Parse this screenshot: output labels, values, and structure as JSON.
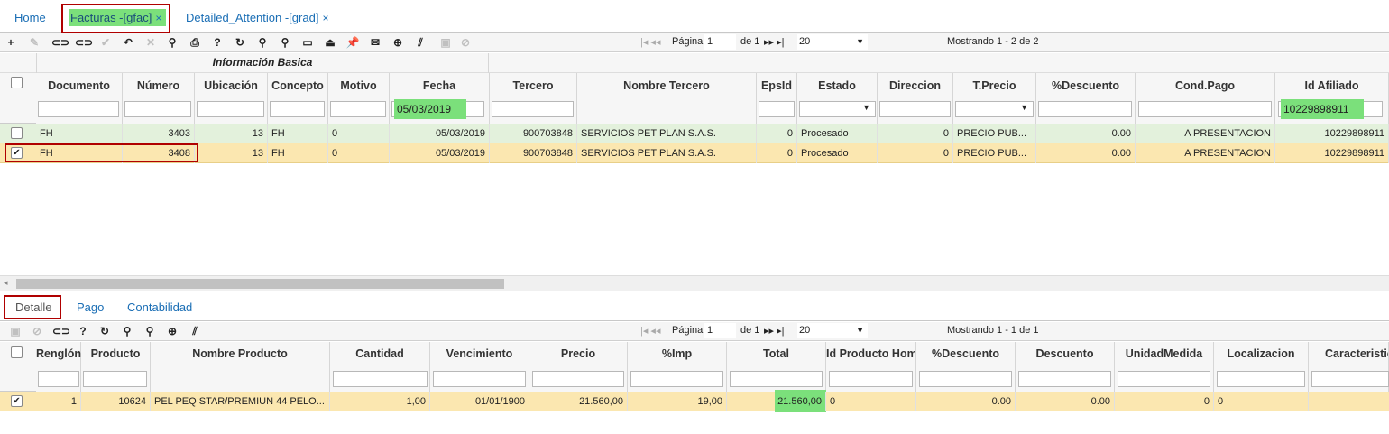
{
  "tabs": [
    {
      "label": "Home"
    },
    {
      "label": "Facturas -[gfac]",
      "close": "×",
      "active": true
    },
    {
      "label": "Detailed_Attention -[grad]",
      "close": "×"
    }
  ],
  "top_pager": {
    "page_label": "Página",
    "page_value": "1",
    "of_label": "de 1",
    "page_size": "20",
    "showing": "Mostrando 1 - 2 de 2"
  },
  "group_header": "Información Basica",
  "top_columns": [
    "Documento",
    "Número",
    "Ubicación",
    "Concepto",
    "Motivo",
    "Fecha",
    "Tercero",
    "Nombre Tercero",
    "EpsId",
    "Estado",
    "Direccion",
    "T.Precio",
    "%Descuento",
    "Cond.Pago",
    "Id Afiliado"
  ],
  "top_filters": {
    "fecha": "05/03/2019",
    "id_afiliado": "10229898911"
  },
  "top_rows": [
    {
      "checked": false,
      "documento": "FH",
      "numero": "3403",
      "ubicacion": "13",
      "concepto": "FH",
      "motivo": "0",
      "fecha": "05/03/2019",
      "tercero": "900703848",
      "nombre": "SERVICIOS PET PLAN S.A.S.",
      "epsid": "0",
      "estado": "Procesado",
      "direccion": "0",
      "tprecio": "PRECIO PUB...",
      "descuento": "0.00",
      "condpago": "A PRESENTACION",
      "afiliado": "10229898911"
    },
    {
      "checked": true,
      "check_mark": "✔",
      "documento": "FH",
      "numero": "3408",
      "ubicacion": "13",
      "concepto": "FH",
      "motivo": "0",
      "fecha": "05/03/2019",
      "tercero": "900703848",
      "nombre": "SERVICIOS PET PLAN S.A.S.",
      "epsid": "0",
      "estado": "Procesado",
      "direccion": "0",
      "tprecio": "PRECIO PUB...",
      "descuento": "0.00",
      "condpago": "A PRESENTACION",
      "afiliado": "10229898911"
    }
  ],
  "sub_tabs": [
    "Detalle",
    "Pago",
    "Contabilidad"
  ],
  "bottom_pager": {
    "page_label": "Página",
    "page_value": "1",
    "of_label": "de 1",
    "page_size": "20",
    "showing": "Mostrando 1 - 1 de 1"
  },
  "bottom_columns": [
    "Renglón",
    "Producto",
    "Nombre Producto",
    "Cantidad",
    "Vencimiento",
    "Precio",
    "%Imp",
    "Total",
    "Id Producto Hom",
    "%Descuento",
    "Descuento",
    "UnidadMedida",
    "Localizacion",
    "Caracteristic"
  ],
  "bottom_rows": [
    {
      "checked": true,
      "check_mark": "✔",
      "renglon": "1",
      "producto": "10624",
      "nombre": "PEL PEQ STAR/PREMIUN 44 PELO...",
      "cantidad": "1,00",
      "vencimiento": "01/01/1900",
      "precio": "21.560,00",
      "imp": "19,00",
      "total": "21.560,00",
      "idprod": "0",
      "descuento_pct": "0.00",
      "descuento": "0.00",
      "unidad": "0",
      "localizacion": "0"
    }
  ],
  "colors": {
    "accent": "#1a6eb5",
    "highlight_green": "#7be07b",
    "row_selected": "#fbe7b0",
    "row_processed": "#e3f1dc",
    "marker_red": "#b00000"
  },
  "toolbar_icons": [
    "plus-icon",
    "edit-icon",
    "tag-icon",
    "tag-icon",
    "check-icon",
    "undo-icon",
    "delete-icon",
    "search-icon",
    "print-icon",
    "help-icon",
    "refresh-icon",
    "zoom-in-icon",
    "zoom-out-icon",
    "comment-icon",
    "stamp-icon",
    "pin-icon",
    "mail-icon",
    "add-circle-icon",
    "resize-icon",
    "save-icon",
    "cancel-icon"
  ]
}
